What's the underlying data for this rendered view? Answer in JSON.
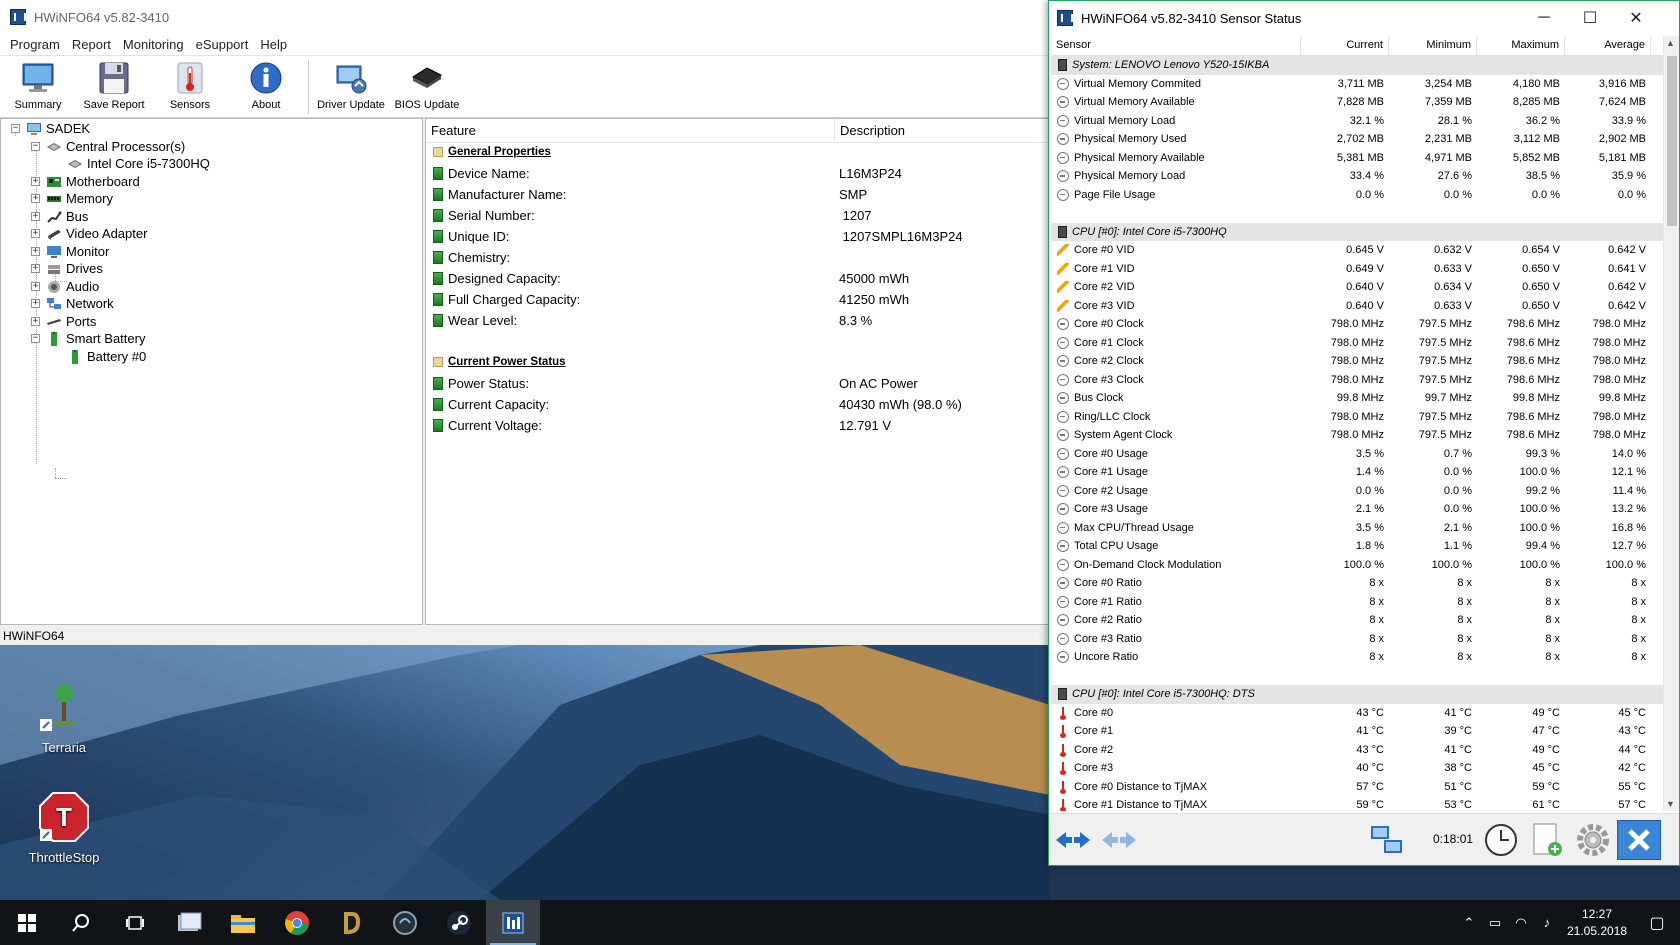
{
  "main_window": {
    "title": "HWiNFO64 v5.82-3410",
    "menu": [
      "Program",
      "Report",
      "Monitoring",
      "eSupport",
      "Help"
    ],
    "toolbar": {
      "summary": "Summary",
      "save_report": "Save Report",
      "sensors": "Sensors",
      "about": "About",
      "driver_update": "Driver Update",
      "bios_update": "BIOS Update"
    },
    "tree": {
      "root": "SADEK",
      "cpu": "Central Processor(s)",
      "cpu_child": "Intel Core i5-7300HQ",
      "motherboard": "Motherboard",
      "memory": "Memory",
      "bus": "Bus",
      "video": "Video Adapter",
      "monitor": "Monitor",
      "drives": "Drives",
      "audio": "Audio",
      "network": "Network",
      "ports": "Ports",
      "battery": "Smart Battery",
      "battery_child": "Battery #0"
    },
    "details": {
      "col_feature": "Feature",
      "col_description": "Description",
      "sections": [
        {
          "title": "General Properties",
          "rows": [
            {
              "feature": "Device Name:",
              "value": "L16M3P24"
            },
            {
              "feature": "Manufacturer Name:",
              "value": "SMP"
            },
            {
              "feature": "Serial Number:",
              "value": " 1207"
            },
            {
              "feature": "Unique ID:",
              "value": " 1207SMPL16M3P24"
            },
            {
              "feature": "Chemistry:",
              "value": ""
            },
            {
              "feature": "Designed Capacity:",
              "value": "45000 mWh"
            },
            {
              "feature": "Full Charged Capacity:",
              "value": "41250 mWh"
            },
            {
              "feature": "Wear Level:",
              "value": "8.3 %"
            }
          ]
        },
        {
          "title": "Current Power Status",
          "rows": [
            {
              "feature": "Power Status:",
              "value": "On AC Power"
            },
            {
              "feature": "Current Capacity:",
              "value": "40430 mWh (98.0 %)"
            },
            {
              "feature": "Current Voltage:",
              "value": "12.791 V"
            }
          ]
        }
      ]
    },
    "status_bar": "HWiNFO64"
  },
  "sensor_window": {
    "title": "HWiNFO64 v5.82-3410 Sensor Status",
    "columns": [
      "Sensor",
      "Current",
      "Minimum",
      "Maximum",
      "Average"
    ],
    "groups": [
      {
        "name": "System: LENOVO Lenovo Y520-15IKBA",
        "rows": [
          {
            "icon": "clock",
            "name": "Virtual Memory Commited",
            "cur": "3,711 MB",
            "min": "3,254 MB",
            "max": "4,180 MB",
            "avg": "3,916 MB"
          },
          {
            "icon": "clock",
            "name": "Virtual Memory Available",
            "cur": "7,828 MB",
            "min": "7,359 MB",
            "max": "8,285 MB",
            "avg": "7,624 MB"
          },
          {
            "icon": "clock",
            "name": "Virtual Memory Load",
            "cur": "32.1 %",
            "min": "28.1 %",
            "max": "36.2 %",
            "avg": "33.9 %"
          },
          {
            "icon": "clock",
            "name": "Physical Memory Used",
            "cur": "2,702 MB",
            "min": "2,231 MB",
            "max": "3,112 MB",
            "avg": "2,902 MB"
          },
          {
            "icon": "clock",
            "name": "Physical Memory Available",
            "cur": "5,381 MB",
            "min": "4,971 MB",
            "max": "5,852 MB",
            "avg": "5,181 MB"
          },
          {
            "icon": "clock",
            "name": "Physical Memory Load",
            "cur": "33.4 %",
            "min": "27.6 %",
            "max": "38.5 %",
            "avg": "35.9 %"
          },
          {
            "icon": "clock",
            "name": "Page File Usage",
            "cur": "0.0 %",
            "min": "0.0 %",
            "max": "0.0 %",
            "avg": "0.0 %"
          }
        ]
      },
      {
        "name": "CPU [#0]: Intel Core i5-7300HQ",
        "rows": [
          {
            "icon": "volt",
            "name": "Core #0 VID",
            "cur": "0.645 V",
            "min": "0.632 V",
            "max": "0.654 V",
            "avg": "0.642 V"
          },
          {
            "icon": "volt",
            "name": "Core #1 VID",
            "cur": "0.649 V",
            "min": "0.633 V",
            "max": "0.650 V",
            "avg": "0.641 V"
          },
          {
            "icon": "volt",
            "name": "Core #2 VID",
            "cur": "0.640 V",
            "min": "0.634 V",
            "max": "0.650 V",
            "avg": "0.642 V"
          },
          {
            "icon": "volt",
            "name": "Core #3 VID",
            "cur": "0.640 V",
            "min": "0.633 V",
            "max": "0.650 V",
            "avg": "0.642 V"
          },
          {
            "icon": "clock",
            "name": "Core #0 Clock",
            "cur": "798.0 MHz",
            "min": "797.5 MHz",
            "max": "798.6 MHz",
            "avg": "798.0 MHz"
          },
          {
            "icon": "clock",
            "name": "Core #1 Clock",
            "cur": "798.0 MHz",
            "min": "797.5 MHz",
            "max": "798.6 MHz",
            "avg": "798.0 MHz"
          },
          {
            "icon": "clock",
            "name": "Core #2 Clock",
            "cur": "798.0 MHz",
            "min": "797.5 MHz",
            "max": "798.6 MHz",
            "avg": "798.0 MHz"
          },
          {
            "icon": "clock",
            "name": "Core #3 Clock",
            "cur": "798.0 MHz",
            "min": "797.5 MHz",
            "max": "798.6 MHz",
            "avg": "798.0 MHz"
          },
          {
            "icon": "clock",
            "name": "Bus Clock",
            "cur": "99.8 MHz",
            "min": "99.7 MHz",
            "max": "99.8 MHz",
            "avg": "99.8 MHz"
          },
          {
            "icon": "clock",
            "name": "Ring/LLC Clock",
            "cur": "798.0 MHz",
            "min": "797.5 MHz",
            "max": "798.6 MHz",
            "avg": "798.0 MHz"
          },
          {
            "icon": "clock",
            "name": "System Agent Clock",
            "cur": "798.0 MHz",
            "min": "797.5 MHz",
            "max": "798.6 MHz",
            "avg": "798.0 MHz"
          },
          {
            "icon": "clock",
            "name": "Core #0 Usage",
            "cur": "3.5 %",
            "min": "0.7 %",
            "max": "99.3 %",
            "avg": "14.0 %"
          },
          {
            "icon": "clock",
            "name": "Core #1 Usage",
            "cur": "1.4 %",
            "min": "0.0 %",
            "max": "100.0 %",
            "avg": "12.1 %"
          },
          {
            "icon": "clock",
            "name": "Core #2 Usage",
            "cur": "0.0 %",
            "min": "0.0 %",
            "max": "99.2 %",
            "avg": "11.4 %"
          },
          {
            "icon": "clock",
            "name": "Core #3 Usage",
            "cur": "2.1 %",
            "min": "0.0 %",
            "max": "100.0 %",
            "avg": "13.2 %"
          },
          {
            "icon": "clock",
            "name": "Max CPU/Thread Usage",
            "cur": "3.5 %",
            "min": "2.1 %",
            "max": "100.0 %",
            "avg": "16.8 %"
          },
          {
            "icon": "clock",
            "name": "Total CPU Usage",
            "cur": "1.8 %",
            "min": "1.1 %",
            "max": "99.4 %",
            "avg": "12.7 %"
          },
          {
            "icon": "clock",
            "name": "On-Demand Clock Modulation",
            "cur": "100.0 %",
            "min": "100.0 %",
            "max": "100.0 %",
            "avg": "100.0 %"
          },
          {
            "icon": "clock",
            "name": "Core #0 Ratio",
            "cur": "8 x",
            "min": "8 x",
            "max": "8 x",
            "avg": "8 x"
          },
          {
            "icon": "clock",
            "name": "Core #1 Ratio",
            "cur": "8 x",
            "min": "8 x",
            "max": "8 x",
            "avg": "8 x"
          },
          {
            "icon": "clock",
            "name": "Core #2 Ratio",
            "cur": "8 x",
            "min": "8 x",
            "max": "8 x",
            "avg": "8 x"
          },
          {
            "icon": "clock",
            "name": "Core #3 Ratio",
            "cur": "8 x",
            "min": "8 x",
            "max": "8 x",
            "avg": "8 x"
          },
          {
            "icon": "clock",
            "name": "Uncore Ratio",
            "cur": "8 x",
            "min": "8 x",
            "max": "8 x",
            "avg": "8 x"
          }
        ]
      },
      {
        "name": "CPU [#0]: Intel Core i5-7300HQ: DTS",
        "rows": [
          {
            "icon": "temp",
            "name": "Core #0",
            "cur": "43 °C",
            "min": "41 °C",
            "max": "49 °C",
            "avg": "45 °C"
          },
          {
            "icon": "temp",
            "name": "Core #1",
            "cur": "41 °C",
            "min": "39 °C",
            "max": "47 °C",
            "avg": "43 °C"
          },
          {
            "icon": "temp",
            "name": "Core #2",
            "cur": "43 °C",
            "min": "41 °C",
            "max": "49 °C",
            "avg": "44 °C"
          },
          {
            "icon": "temp",
            "name": "Core #3",
            "cur": "40 °C",
            "min": "38 °C",
            "max": "45 °C",
            "avg": "42 °C"
          },
          {
            "icon": "temp",
            "name": "Core #0 Distance to TjMAX",
            "cur": "57 °C",
            "min": "51 °C",
            "max": "59 °C",
            "avg": "55 °C"
          },
          {
            "icon": "temp",
            "name": "Core #1 Distance to TjMAX",
            "cur": "59 °C",
            "min": "53 °C",
            "max": "61 °C",
            "avg": "57 °C"
          }
        ]
      }
    ],
    "timer": "0:18:01"
  },
  "desktop": {
    "icons": [
      "Terraria",
      "ThrottleStop"
    ]
  },
  "taskbar": {
    "time": "12:27",
    "date": "21.05.2018"
  }
}
